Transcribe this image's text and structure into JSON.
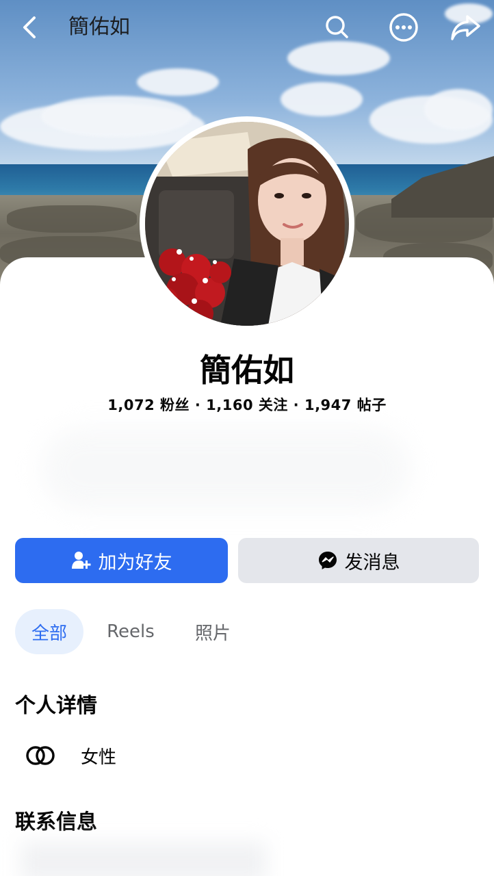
{
  "header": {
    "title": "簡佑如"
  },
  "profile": {
    "name": "簡佑如",
    "stats": "1,072 粉丝 · 1,160 关注 · 1,947 帖子"
  },
  "actions": {
    "add_friend_label": "加为好友",
    "message_label": "发消息"
  },
  "tabs": [
    {
      "label": "全部",
      "selected": true
    },
    {
      "label": "Reels",
      "selected": false
    },
    {
      "label": "照片",
      "selected": false
    }
  ],
  "details": {
    "title": "个人详情",
    "items": [
      {
        "icon": "gender-icon",
        "text": "女性"
      }
    ]
  },
  "contact": {
    "title": "联系信息"
  },
  "colors": {
    "primary": "#2d6cf0",
    "secondary_button": "#e4e6eb",
    "tab_selected_bg": "#e7f0fd",
    "text": "#050505",
    "muted_text": "#65676b"
  }
}
